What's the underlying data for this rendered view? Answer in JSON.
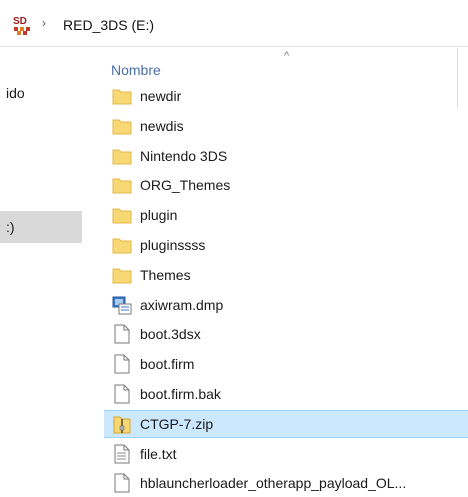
{
  "address": {
    "path": "RED_3DS (E:)",
    "separator": "›"
  },
  "header": {
    "column": "Nombre",
    "sort_arrow": "^"
  },
  "nav": {
    "items": [
      {
        "label": "ido",
        "selected": false
      },
      {
        "label": ":)",
        "selected": true
      }
    ]
  },
  "files": [
    {
      "name": "newdir",
      "icon": "folder-icon"
    },
    {
      "name": "newdis",
      "icon": "folder-icon"
    },
    {
      "name": "Nintendo 3DS",
      "icon": "folder-icon"
    },
    {
      "name": "ORG_Themes",
      "icon": "folder-icon"
    },
    {
      "name": "plugin",
      "icon": "folder-icon"
    },
    {
      "name": "pluginssss",
      "icon": "folder-icon"
    },
    {
      "name": "Themes",
      "icon": "folder-icon"
    },
    {
      "name": "axiwram.dmp",
      "icon": "dump-file-icon"
    },
    {
      "name": "boot.3dsx",
      "icon": "file-icon"
    },
    {
      "name": "boot.firm",
      "icon": "file-icon"
    },
    {
      "name": "boot.firm.bak",
      "icon": "file-icon"
    },
    {
      "name": "CTGP-7.zip",
      "icon": "zip-file-icon",
      "selected": true
    },
    {
      "name": "file.txt",
      "icon": "text-file-icon"
    },
    {
      "name": "hblauncherloader_otherapp_payload_OL...",
      "icon": "file-icon"
    }
  ],
  "colors": {
    "selected_bg": "#cce8ff",
    "folder": "#f8d775",
    "header_text": "#4a6ea9"
  }
}
